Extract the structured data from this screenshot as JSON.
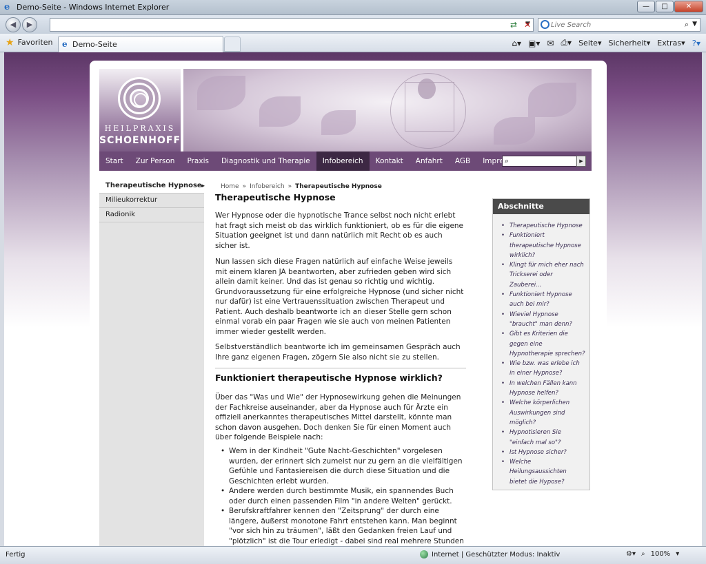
{
  "window": {
    "title": "Demo-Seite - Windows Internet Explorer",
    "controls": [
      "—",
      "□",
      "✕"
    ]
  },
  "browser": {
    "search_placeholder": "Live Search",
    "favorites_label": "Favoriten",
    "tab_title": "Demo-Seite",
    "commands": {
      "page": "Seite",
      "security": "Sicherheit",
      "extras": "Extras"
    }
  },
  "site": {
    "logo": {
      "line1": "HEILPRAXIS",
      "line2": "SCHOENHOFF"
    },
    "menu": [
      "Start",
      "Zur Person",
      "Praxis",
      "Diagnostik und Therapie",
      "Infobereich",
      "Kontakt",
      "Anfahrt",
      "AGB",
      "Impressum"
    ],
    "active_menu": "Infobereich",
    "sidebar": [
      "Therapeutische Hypnose",
      "Milieukorrektur",
      "Radionik"
    ],
    "breadcrumb": {
      "home": "Home",
      "section": "Infobereich",
      "current": "Therapeutische Hypnose",
      "separator": "»"
    },
    "heading": "Therapeutische Hypnose",
    "paragraphs": [
      "Wer Hypnose oder die hypnotische Trance selbst noch nicht erlebt hat fragt sich meist ob das wirklich funktioniert, ob es für die eigene Situation geeignet ist und dann natürlich mit Recht ob es auch sicher ist.",
      "Nun lassen sich diese Fragen natürlich auf einfache Weise jeweils mit einem klaren JA beantworten, aber zufrieden geben wird sich allein damit keiner. Und das ist genau so richtig und wichtig. Grundvoraussetzung für eine erfolgreiche Hypnose (und sicher nicht nur dafür) ist eine Vertrauenssituation zwischen Therapeut und Patient. Auch deshalb beantworte ich an dieser Stelle gern schon einmal vorab ein paar Fragen wie sie auch von meinen Patienten immer wieder gestellt werden.",
      "Selbstverständlich beantworte ich im gemeinsamen Gespräch auch Ihre ganz eigenen Fragen, zögern Sie also nicht sie zu stellen."
    ],
    "subheading": "Funktioniert therapeutische Hypnose wirklich?",
    "paragraph4": "Über das \"Was und Wie\" der Hypnosewirkung gehen die Meinungen der Fachkreise auseinander, aber da Hypnose auch für Ärzte ein offiziell anerkanntes therapeutisches Mittel darstellt, könnte man schon davon ausgehen. Doch denken Sie für einen Moment auch über folgende Beispiele nach:",
    "bullets": [
      "Wem in der Kindheit \"Gute Nacht-Geschichten\" vorgelesen wurden, der erinnert sich zumeist nur zu gern an die vielfältigen Gefühle und Fantasiereisen die durch diese Situation und die Geschichten erlebt wurden.",
      "Andere werden durch bestimmte Musik, ein spannendes Buch oder durch einen passenden Film \"in andere Welten\" gerückt.",
      "Berufskraftfahrer kennen den \"Zeitsprung\" der durch eine längere, äußerst monotone Fahrt entstehen kann. Man beginnt \"vor sich hin zu träumen\", läßt den Gedanken freien Lauf und \"plötzlich\" ist die Tour erledigt - dabei sind real mehrere Stunden vergangen."
    ],
    "toc_title": "Abschnitte",
    "toc": [
      "Therapeutische Hypnose",
      "Funktioniert therapeutische Hypnose wirklich?",
      "Klingt für mich eher nach Trickserei oder Zauberei...",
      "Funktioniert Hypnose auch bei mir?",
      "Wieviel Hypnose \"braucht\" man denn?",
      "Gibt es Kriterien die gegen eine Hypnotherapie sprechen?",
      "Wie bzw. was erlebe ich in einer Hypnose?",
      "In welchen Fällen kann Hypnose helfen?",
      "Welche körperlichen Auswirkungen sind möglich?",
      "Hypnotisieren Sie \"einfach mal so\"?",
      "Ist Hypnose sicher?",
      "Welche Heilungsaussichten bietet die Hypose?"
    ]
  },
  "status": {
    "left": "Fertig",
    "zone": "Internet | Geschützter Modus: Inaktiv",
    "zoom": "100%"
  }
}
